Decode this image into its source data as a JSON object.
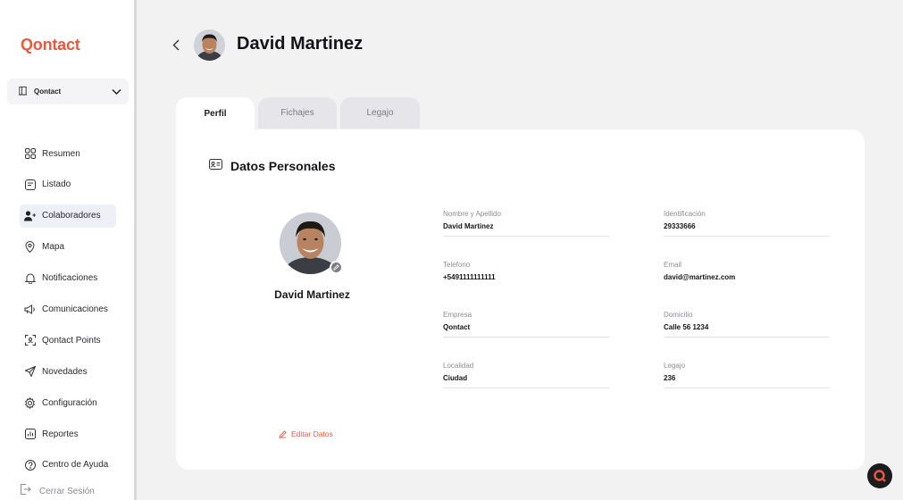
{
  "app": {
    "logo": "Qontact"
  },
  "org_selector": {
    "value": "Qontact"
  },
  "sidebar": {
    "items": [
      {
        "label": "Resumen",
        "icon": "grid-icon"
      },
      {
        "label": "Listado",
        "icon": "list-icon"
      },
      {
        "label": "Colaboradores",
        "icon": "user-plus-icon",
        "active": true
      },
      {
        "label": "Mapa",
        "icon": "map-pin-icon"
      },
      {
        "label": "Notificaciones",
        "icon": "bell-icon"
      },
      {
        "label": "Comunicaciones",
        "icon": "megaphone-icon"
      },
      {
        "label": "Qontact Points",
        "icon": "scan-icon"
      },
      {
        "label": "Novedades",
        "icon": "send-icon"
      },
      {
        "label": "Configuración",
        "icon": "gear-icon"
      },
      {
        "label": "Reportes",
        "icon": "chart-icon"
      },
      {
        "label": "Centro de Ayuda",
        "icon": "help-icon"
      }
    ],
    "logout": "Cerrar Sesión"
  },
  "header": {
    "title": "David Martinez"
  },
  "tabs": [
    {
      "label": "Perfil",
      "active": true
    },
    {
      "label": "Fichajes",
      "active": false
    },
    {
      "label": "Legajo",
      "active": false
    }
  ],
  "profile": {
    "section_title": "Datos Personales",
    "name": "David Martinez",
    "edit_label": "Editar Datos",
    "fields": [
      {
        "label": "Nombre y Apellido",
        "value": "David Martinez"
      },
      {
        "label": "Identificación",
        "value": "29333666"
      },
      {
        "label": "Telefono",
        "value": "+5491111111111"
      },
      {
        "label": "Email",
        "value": "david@martinez.com"
      },
      {
        "label": "Empresa",
        "value": "Qontact"
      },
      {
        "label": "Domicilio",
        "value": "Calle 56 1234"
      },
      {
        "label": "Localidad",
        "value": "Ciudad"
      },
      {
        "label": "Legajo",
        "value": "236"
      }
    ]
  },
  "colors": {
    "accent": "#e8593a",
    "background": "#f2f2f3",
    "card": "#ffffff"
  }
}
